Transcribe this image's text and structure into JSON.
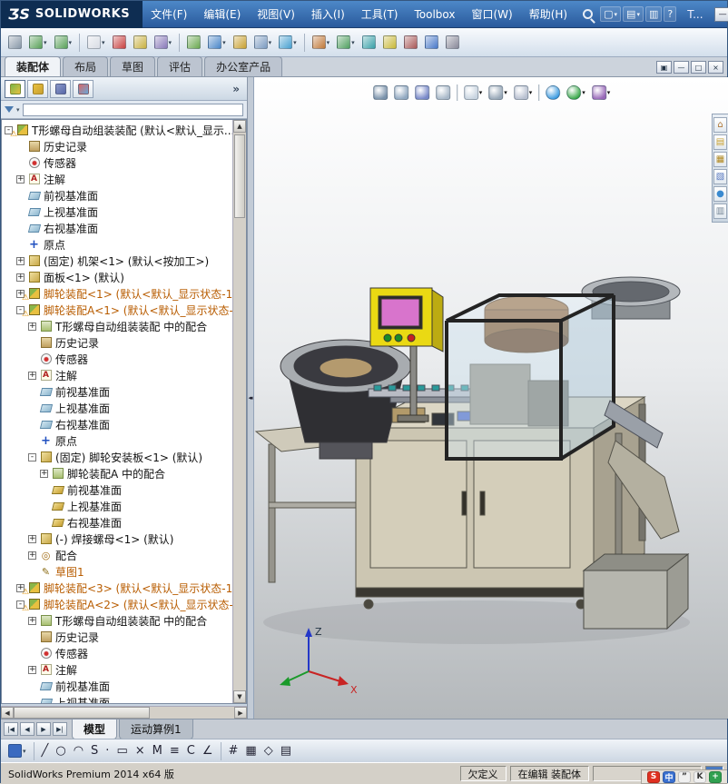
{
  "titlebar": {
    "brand_mark": "ƷS",
    "brand": "SOLIDWORKS",
    "menus": [
      "文件(F)",
      "编辑(E)",
      "视图(V)",
      "插入(I)",
      "工具(T)",
      "Toolbox",
      "窗口(W)",
      "帮助(H)"
    ],
    "truncated_label": "T...",
    "quick_tools": [
      {
        "name": "new-document-icon",
        "glyph": "▢",
        "caret": true
      },
      {
        "name": "open-document-icon",
        "glyph": "▤",
        "caret": true
      },
      {
        "name": "save-document-icon",
        "glyph": "▥",
        "caret": false
      },
      {
        "name": "help-icon",
        "glyph": "?",
        "caret": false
      }
    ],
    "window_buttons": [
      {
        "name": "minimize-button",
        "glyph": "—"
      },
      {
        "name": "maximize-button",
        "glyph": "□"
      },
      {
        "name": "close-button",
        "glyph": "×"
      }
    ]
  },
  "standard_toolbar": [
    {
      "name": "print-icon",
      "c": "#8898a8"
    },
    {
      "name": "undo-icon",
      "c": "#58a058",
      "caret": true
    },
    {
      "name": "redo-icon",
      "c": "#58a058",
      "caret": true
    },
    {
      "sep": true
    },
    {
      "name": "select-icon",
      "c": "#d8dce4",
      "caret": true
    },
    {
      "name": "rebuild-icon",
      "c": "#c84040"
    },
    {
      "name": "file-properties-icon",
      "c": "#c8b040"
    },
    {
      "name": "options-icon",
      "c": "#8878b8",
      "caret": true
    },
    {
      "sep": true
    },
    {
      "name": "edit-component-icon",
      "c": "#6aa84f"
    },
    {
      "name": "insert-components-icon",
      "c": "#4a86c8",
      "caret": true
    },
    {
      "name": "mate-icon",
      "c": "#c8a030"
    },
    {
      "name": "component-pattern-icon",
      "c": "#7a9ac0",
      "caret": true
    },
    {
      "name": "move-component-icon",
      "c": "#48a0d0",
      "caret": true
    },
    {
      "sep": true
    },
    {
      "name": "assembly-features-icon",
      "c": "#c07838",
      "caret": true
    },
    {
      "name": "reference-geometry-icon",
      "c": "#50a060",
      "caret": true
    },
    {
      "name": "bill-of-materials-icon",
      "c": "#38a0a8"
    },
    {
      "name": "exploded-view-icon",
      "c": "#c8b838"
    },
    {
      "name": "interference-detection-icon",
      "c": "#a85858"
    },
    {
      "name": "measure-icon",
      "c": "#4878c8"
    },
    {
      "name": "mass-properties-icon",
      "c": "#888898"
    }
  ],
  "commandmanager_tabs": [
    "装配体",
    "布局",
    "草图",
    "评估",
    "办公室产品"
  ],
  "document_controls": [
    {
      "name": "tile-windows-button",
      "glyph": "▣"
    },
    {
      "name": "doc-minimize-button",
      "glyph": "—"
    },
    {
      "name": "doc-restore-button",
      "glyph": "□"
    },
    {
      "name": "doc-close-button",
      "glyph": "×"
    }
  ],
  "panel": {
    "chevron": "»",
    "tabs": [
      {
        "name": "featuremanager-tab",
        "c": "#7ab648,#e8c040",
        "active": true
      },
      {
        "name": "propertymanager-tab",
        "c": "#e8c040,#c8a030",
        "active": false
      },
      {
        "name": "configurationmanager-tab",
        "c": "#8a98c8,#5868a8",
        "active": false
      },
      {
        "name": "displaymanager-tab",
        "c": "#d86868,#68a8d8",
        "active": false
      }
    ]
  },
  "tree": {
    "items": [
      {
        "t": "T形螺母自动组装装配 (默认<默认_显示...",
        "i": "asm",
        "lv": 0,
        "ex": "-",
        "warn": true
      },
      {
        "t": "历史记录",
        "i": "hist",
        "lv": 1
      },
      {
        "t": "传感器",
        "i": "sensor",
        "lv": 1
      },
      {
        "t": "注解",
        "i": "ann",
        "lv": 1,
        "ex": "+"
      },
      {
        "t": "前视基准面",
        "i": "plane",
        "lv": 1
      },
      {
        "t": "上视基准面",
        "i": "plane",
        "lv": 1
      },
      {
        "t": "右视基准面",
        "i": "plane",
        "lv": 1
      },
      {
        "t": "原点",
        "i": "origin",
        "lv": 1
      },
      {
        "t": "(固定) 机架<1> (默认<按加工>)",
        "i": "part",
        "lv": 1,
        "ex": "+"
      },
      {
        "t": "面板<1> (默认)",
        "i": "part",
        "lv": 1,
        "ex": "+"
      },
      {
        "t": "脚轮装配<1> (默认<默认_显示状态-1",
        "i": "asm",
        "lv": 1,
        "ex": "+",
        "warn": true,
        "o": true
      },
      {
        "t": "脚轮装配A<1> (默认<默认_显示状态-",
        "i": "asm",
        "lv": 1,
        "ex": "-",
        "warn": true,
        "o": true
      },
      {
        "t": "T形螺母自动组装装配 中的配合",
        "i": "matefolder",
        "lv": 2,
        "ex": "+"
      },
      {
        "t": "历史记录",
        "i": "hist",
        "lv": 2
      },
      {
        "t": "传感器",
        "i": "sensor",
        "lv": 2
      },
      {
        "t": "注解",
        "i": "ann",
        "lv": 2,
        "ex": "+"
      },
      {
        "t": "前视基准面",
        "i": "plane",
        "lv": 2
      },
      {
        "t": "上视基准面",
        "i": "plane",
        "lv": 2
      },
      {
        "t": "右视基准面",
        "i": "plane",
        "lv": 2
      },
      {
        "t": "原点",
        "i": "origin",
        "lv": 2
      },
      {
        "t": "(固定) 脚轮安装板<1> (默认)",
        "i": "part",
        "lv": 2,
        "ex": "-"
      },
      {
        "t": "脚轮装配A 中的配合",
        "i": "matefolder",
        "lv": 3,
        "ex": "+"
      },
      {
        "t": "前视基准面",
        "i": "plane",
        "lv": 3,
        "g": true
      },
      {
        "t": "上视基准面",
        "i": "plane",
        "lv": 3,
        "g": true
      },
      {
        "t": "右视基准面",
        "i": "plane",
        "lv": 3,
        "g": true
      },
      {
        "t": "(-) 焊接螺母<1> (默认)",
        "i": "part",
        "lv": 2,
        "ex": "+"
      },
      {
        "t": "配合",
        "i": "mates",
        "lv": 2,
        "ex": "+"
      },
      {
        "t": "草图1",
        "i": "sketch",
        "lv": 2,
        "o": true
      },
      {
        "t": "脚轮装配<3> (默认<默认_显示状态-1",
        "i": "asm",
        "lv": 1,
        "ex": "+",
        "warn": true,
        "o": true
      },
      {
        "t": "脚轮装配A<2> (默认<默认_显示状态-",
        "i": "asm",
        "lv": 1,
        "ex": "-",
        "warn": true,
        "o": true
      },
      {
        "t": "T形螺母自动组装装配 中的配合",
        "i": "matefolder",
        "lv": 2,
        "ex": "+"
      },
      {
        "t": "历史记录",
        "i": "hist",
        "lv": 2
      },
      {
        "t": "传感器",
        "i": "sensor",
        "lv": 2
      },
      {
        "t": "注解",
        "i": "ann",
        "lv": 2,
        "ex": "+"
      },
      {
        "t": "前视基准面",
        "i": "plane",
        "lv": 2
      },
      {
        "t": "上视基准面",
        "i": "plane",
        "lv": 2
      }
    ]
  },
  "viewport": {
    "headsup": [
      {
        "name": "zoom-fit-icon",
        "c": "#7a92aa"
      },
      {
        "name": "zoom-area-icon",
        "c": "#90a8c0"
      },
      {
        "name": "previous-view-icon",
        "c": "#7888c8"
      },
      {
        "name": "section-view-icon",
        "c": "#a8b8c8"
      },
      {
        "sep": true
      },
      {
        "name": "view-orientation-icon",
        "c": "#c8d4e0",
        "caret": true
      },
      {
        "name": "display-style-icon",
        "c": "#98a8b8",
        "caret": true
      },
      {
        "name": "hide-show-items-icon",
        "c": "#b8c0d0",
        "caret": true
      },
      {
        "sep": true
      },
      {
        "name": "edit-appearance-icon",
        "c": "#3a9ae0",
        "round": true
      },
      {
        "name": "apply-scene-icon",
        "c": "#38a848",
        "round": true,
        "caret": true
      },
      {
        "name": "view-settings-icon",
        "c": "#9868b8",
        "caret": true
      }
    ],
    "taskpane": [
      {
        "name": "solidworks-resources-icon",
        "glyph": "⌂",
        "color": "#b07838"
      },
      {
        "name": "design-library-icon",
        "glyph": "▤",
        "color": "#c8a030"
      },
      {
        "name": "file-explorer-icon",
        "glyph": "▦",
        "color": "#b08820"
      },
      {
        "name": "view-palette-icon",
        "glyph": "▧",
        "color": "#5878c0"
      },
      {
        "name": "appearances-scenes-icon",
        "glyph": "●",
        "color": "#3a8ad0"
      },
      {
        "name": "custom-properties-icon",
        "glyph": "▥",
        "color": "#788898"
      }
    ],
    "triad": {
      "z": "Z",
      "x": "X"
    }
  },
  "bottom": {
    "nav": [
      "|◀",
      "◀",
      "▶",
      "▶|"
    ],
    "tabs": [
      {
        "label": "模型",
        "active": true
      },
      {
        "label": "运动算例1",
        "active": false
      }
    ]
  },
  "sketch_toolbar": [
    {
      "name": "save-icon",
      "c": "#3a6ac0",
      "caret": true
    },
    {
      "sep": true
    },
    {
      "name": "line-icon",
      "g": "╱"
    },
    {
      "name": "circle-icon",
      "g": "○"
    },
    {
      "name": "arc-icon",
      "g": "◠"
    },
    {
      "name": "spline-icon",
      "g": "S"
    },
    {
      "name": "point-icon",
      "g": "·"
    },
    {
      "name": "rectangle-icon",
      "g": "▭"
    },
    {
      "name": "trim-entities-icon",
      "g": "×"
    },
    {
      "name": "mirror-entities-icon",
      "g": "M"
    },
    {
      "name": "offset-entities-icon",
      "g": "≡"
    },
    {
      "name": "convert-entities-icon",
      "g": "C"
    },
    {
      "name": "smart-dimension-icon",
      "g": "∠"
    },
    {
      "sep": true
    },
    {
      "name": "grid-icon",
      "g": "#"
    },
    {
      "name": "snap-icon",
      "g": "▦"
    },
    {
      "name": "plane-icon",
      "g": "◇"
    },
    {
      "name": "design-table-icon",
      "g": "▤"
    }
  ],
  "statusbar": {
    "left": "SolidWorks Premium 2014 x64 版",
    "defined": "欠定义",
    "editing": "在编辑 装配体",
    "quick_tips": "?"
  },
  "icons": {
    "splitter_grip": "◂◂"
  },
  "taskbar": [
    {
      "name": "sogou-input-icon",
      "label": "S",
      "bg": "#e03020",
      "fg": "#ffffff"
    },
    {
      "name": "ime-chinese-icon",
      "label": "中",
      "bg": "#3a70d0",
      "fg": "#ffffff"
    },
    {
      "name": "ime-punctuation-icon",
      "label": "”",
      "bg": "#f0f0f0",
      "fg": "#333333"
    },
    {
      "name": "ime-keyboard-icon",
      "label": "K",
      "bg": "#f0f0f0",
      "fg": "#333333"
    },
    {
      "name": "ime-toolbox-icon",
      "label": "+",
      "bg": "#30a050",
      "fg": "#ffffff"
    }
  ]
}
